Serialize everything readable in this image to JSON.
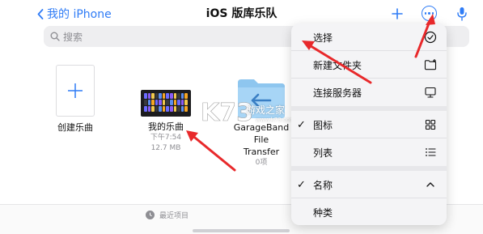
{
  "nav": {
    "back_label": "我的 iPhone",
    "title": "iOS 版库乐队",
    "add_icon": "plus-icon",
    "more_icon": "ellipsis-circle-icon",
    "mic_icon": "microphone-icon"
  },
  "search": {
    "placeholder": "搜索"
  },
  "files": [
    {
      "label": "创建乐曲"
    },
    {
      "label": "我的乐曲",
      "time": "下午7:54",
      "size": "12.7 MB"
    },
    {
      "label_line1": "GarageBand File",
      "label_line2": "Transfer",
      "count": "0项"
    }
  ],
  "menu": {
    "items": [
      {
        "label": "选择",
        "icon": "checkmark-circle-icon"
      },
      {
        "label": "新建文件夹",
        "icon": "folder-plus-icon"
      },
      {
        "label": "连接服务器",
        "icon": "display-icon"
      },
      {
        "label": "图标",
        "checked": "✓",
        "icon": "grid-icon"
      },
      {
        "label": "列表",
        "icon": "list-icon"
      },
      {
        "label": "名称",
        "checked": "✓",
        "icon": "chevron-up-icon"
      },
      {
        "label": "种类"
      }
    ]
  },
  "bottom": {
    "recent_label": "最近项目"
  },
  "watermark": {
    "text": "游戏之家",
    "logo": "K73",
    "sub": "www.k73.com"
  },
  "colors": {
    "accent": "#2f7cf6",
    "arrow": "#e8292b",
    "folder": "#8ec6ef"
  }
}
